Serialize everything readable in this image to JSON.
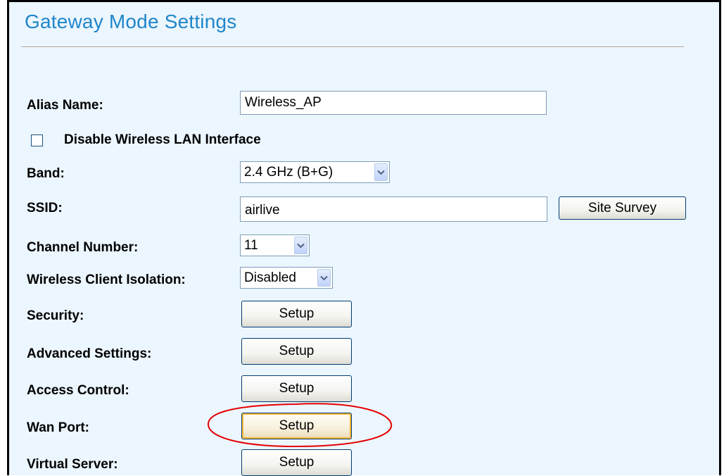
{
  "page": {
    "title": "Gateway Mode Settings"
  },
  "alias": {
    "label": "Alias Name:",
    "value": "Wireless_AP"
  },
  "disable_wlan": {
    "label": "Disable Wireless LAN Interface",
    "checked": false
  },
  "band": {
    "label": "Band:",
    "value": "2.4 GHz (B+G)"
  },
  "ssid": {
    "label": "SSID:",
    "value": "airlive",
    "site_survey_label": "Site Survey"
  },
  "channel": {
    "label": "Channel Number:",
    "value": "11"
  },
  "isolation": {
    "label": "Wireless Client Isolation:",
    "value": "Disabled"
  },
  "security": {
    "label": "Security:",
    "button": "Setup"
  },
  "advanced": {
    "label": "Advanced Settings:",
    "button": "Setup"
  },
  "access_control": {
    "label": "Access Control:",
    "button": "Setup"
  },
  "wan_port": {
    "label": "Wan Port:",
    "button": "Setup"
  },
  "virtual_server": {
    "label": "Virtual Server:",
    "button": "Setup"
  },
  "colors": {
    "title": "#1f86c9",
    "panel_bg": "#ecf6ff",
    "highlight_ellipse": "#e60000",
    "button_hover_border": "#f8b636"
  },
  "icons": {
    "dropdown": "chevron-down-icon",
    "annotation": "red-ellipse-highlight"
  }
}
